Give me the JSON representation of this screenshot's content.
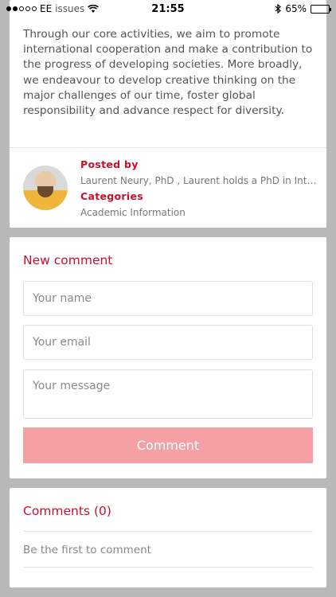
{
  "status_bar": {
    "carrier": "EE",
    "overlay_text": "issues",
    "time": "21:55",
    "battery": "65%",
    "battery_level": 0.65
  },
  "article": {
    "text": "Through our core activities, we aim to promote international cooperation and make a contribution to the progress of developing societies. More broadly, we endeavour to develop creative thinking on the major challenges of our time, foster global responsibility and advance respect for diversity.",
    "posted_by_label": "Posted by",
    "posted_by_value": "Laurent Neury, PhD , Laurent holds a PhD in International Relations",
    "categories_label": "Categories",
    "categories_value": "Academic Information"
  },
  "form": {
    "title": "New comment",
    "name_placeholder": "Your name",
    "email_placeholder": "Your email",
    "message_placeholder": "Your message",
    "submit_label": "Comment"
  },
  "comments": {
    "title": "Comments (0)",
    "empty_text": "Be the first to comment"
  },
  "colors": {
    "accent": "#c8102e",
    "button_disabled": "#f4a0a5",
    "background": "#b9b9b9"
  }
}
